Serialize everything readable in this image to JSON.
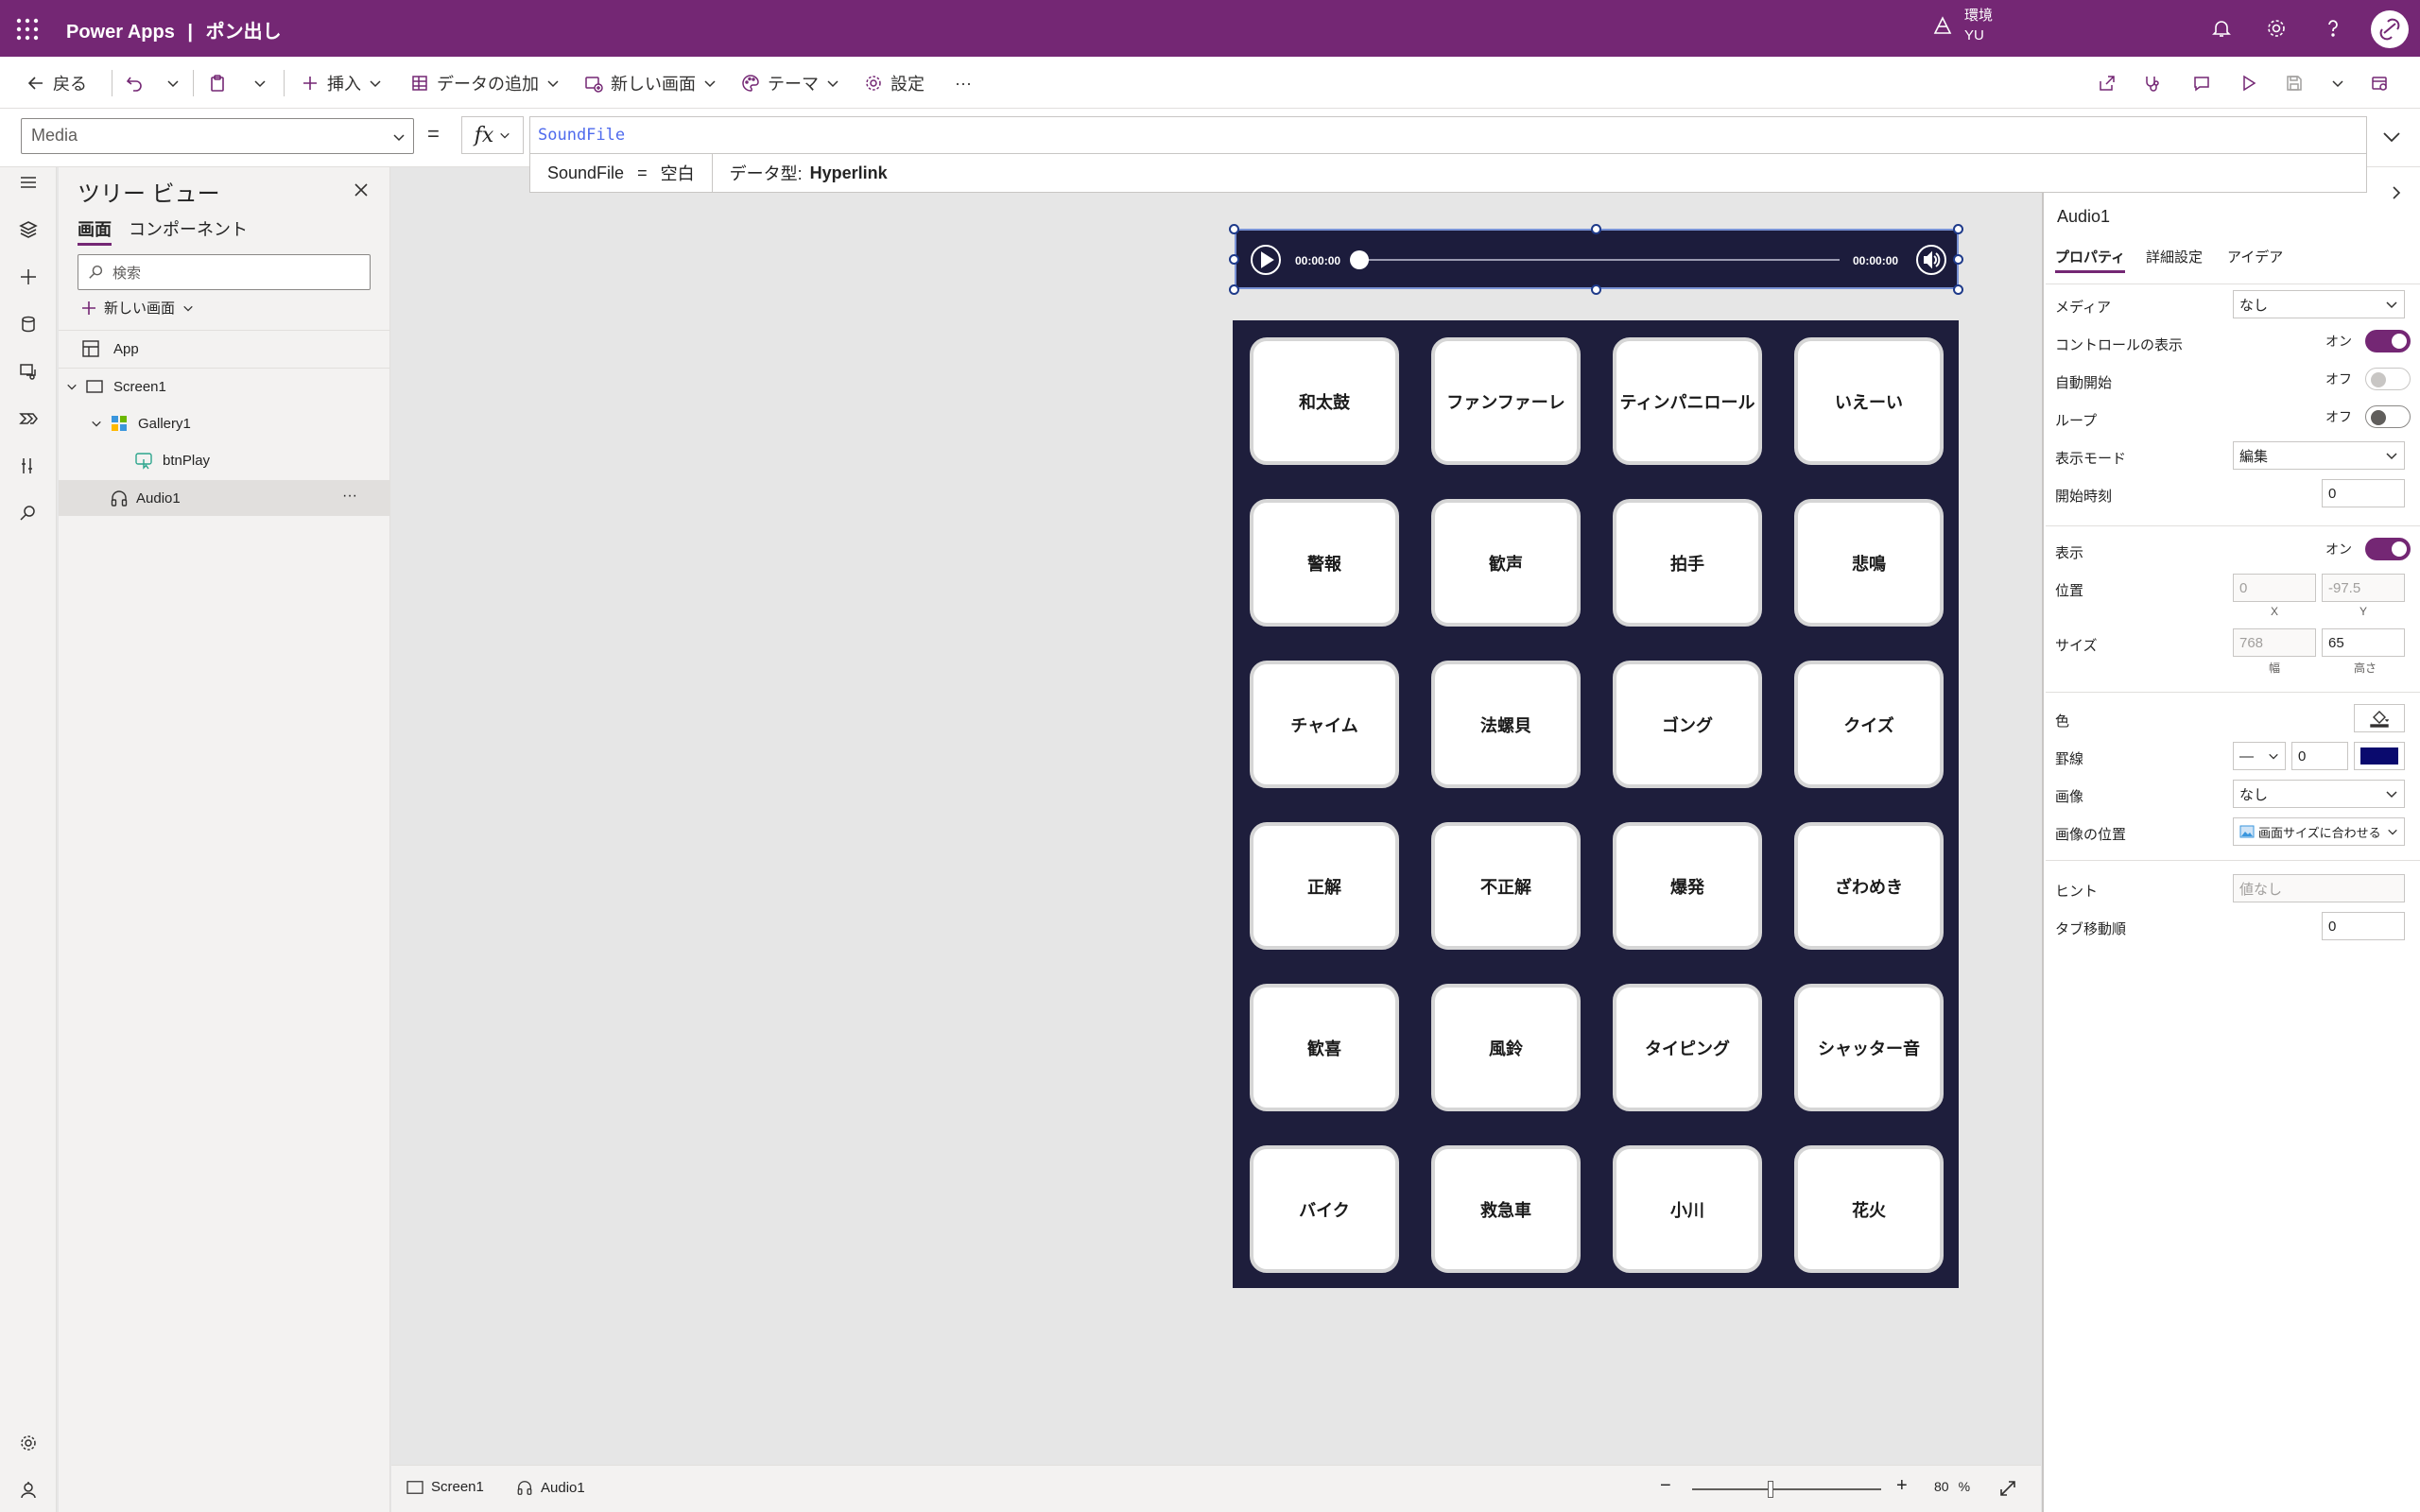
{
  "header": {
    "app_name": "Power Apps",
    "app_title": "ポン出し",
    "env_label": "環境",
    "env_user": "YU"
  },
  "commands": {
    "back": "戻る",
    "insert": "挿入",
    "add_data": "データの追加",
    "new_screen": "新しい画面",
    "theme": "テーマ",
    "settings": "設定",
    "more": "···"
  },
  "formula_bar": {
    "property": "Media",
    "equals": "=",
    "fx": "fx",
    "formula": "SoundFile",
    "tooltip_name": "SoundFile",
    "tooltip_eq": "=",
    "tooltip_value": "空白",
    "tooltip_type_label": "データ型:",
    "tooltip_type": "Hyperlink"
  },
  "tree": {
    "title": "ツリー ビュー",
    "tabs": [
      "画面",
      "コンポーネント"
    ],
    "search_placeholder": "検索",
    "new_screen": "新しい画面",
    "nodes": [
      {
        "label": "App"
      },
      {
        "label": "Screen1"
      },
      {
        "label": "Gallery1"
      },
      {
        "label": "btnPlay"
      },
      {
        "label": "Audio1"
      }
    ],
    "node_more": "···"
  },
  "audio": {
    "time_current": "00:00:00",
    "time_total": "00:00:00"
  },
  "gallery": {
    "buttons": [
      "和太鼓",
      "ファンファーレ",
      "ティンパニロール",
      "いえーい",
      "警報",
      "歓声",
      "拍手",
      "悲鳴",
      "チャイム",
      "法螺貝",
      "ゴング",
      "クイズ",
      "正解",
      "不正解",
      "爆発",
      "ざわめき",
      "歓喜",
      "風鈴",
      "タイピング",
      "シャッター音",
      "バイク",
      "救急車",
      "小川",
      "花火"
    ]
  },
  "properties": {
    "control_name": "Audio1",
    "tabs": [
      "プロパティ",
      "詳細設定",
      "アイデア"
    ],
    "media_label": "メディア",
    "media_value": "なし",
    "show_controls_label": "コントロールの表示",
    "show_controls_state": "オン",
    "autostart_label": "自動開始",
    "autostart_state": "オフ",
    "loop_label": "ループ",
    "loop_state": "オフ",
    "display_mode_label": "表示モード",
    "display_mode_value": "編集",
    "start_time_label": "開始時刻",
    "start_time_value": "0",
    "visible_label": "表示",
    "visible_state": "オン",
    "position_label": "位置",
    "pos_x": "0",
    "pos_y": "-97.5",
    "pos_x_label": "X",
    "pos_y_label": "Y",
    "size_label": "サイズ",
    "width": "768",
    "height": "65",
    "width_label": "幅",
    "height_label": "高さ",
    "color_label": "色",
    "border_label": "罫線",
    "border_style": "—",
    "border_width": "0",
    "border_color": "#0a0a6e",
    "image_label": "画像",
    "image_value": "なし",
    "image_position_label": "画像の位置",
    "image_position_value": "画面サイズに合わせる",
    "hint_label": "ヒント",
    "hint_placeholder": "値なし",
    "tab_index_label": "タブ移動順",
    "tab_index_value": "0"
  },
  "status_bar": {
    "screen": "Screen1",
    "control": "Audio1",
    "zoom_minus": "−",
    "zoom_plus": "+",
    "zoom_value": "80",
    "zoom_unit": "%",
    "zoom_level": 0.8
  },
  "colors": {
    "brand": "#742774",
    "gallery_bg": "#1e1e3c",
    "audio_bg": "#1c1c3c"
  }
}
